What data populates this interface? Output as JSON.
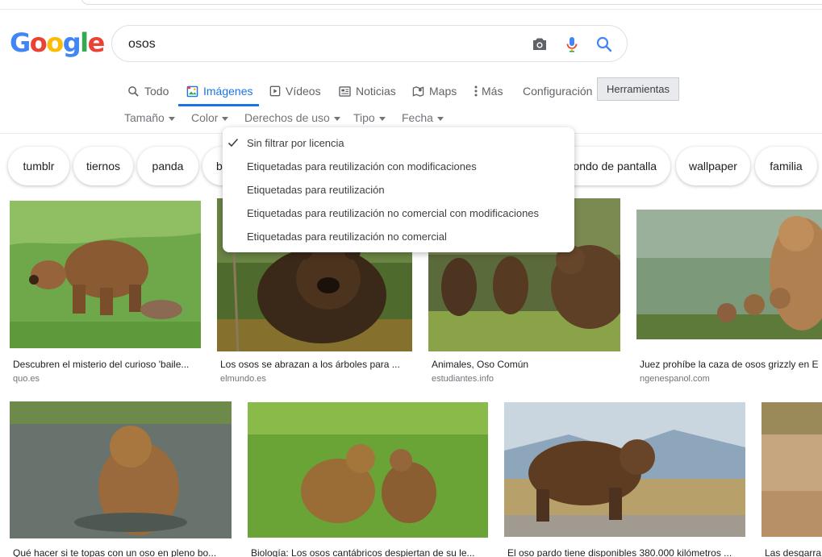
{
  "search": {
    "logo": "Google",
    "query": "osos"
  },
  "nav": {
    "tabs": [
      {
        "label": "Todo",
        "icon": "search-icon"
      },
      {
        "label": "Imágenes",
        "icon": "image-icon",
        "active": true
      },
      {
        "label": "Vídeos",
        "icon": "video-icon"
      },
      {
        "label": "Noticias",
        "icon": "news-icon"
      },
      {
        "label": "Maps",
        "icon": "map-icon"
      },
      {
        "label": "Más",
        "icon": "more-vertical-icon"
      },
      {
        "label": "Configuración"
      }
    ],
    "tools_label": "Herramientas"
  },
  "filters": [
    {
      "label": "Tamaño"
    },
    {
      "label": "Color"
    },
    {
      "label": "Derechos de uso"
    },
    {
      "label": "Tipo"
    },
    {
      "label": "Fecha"
    }
  ],
  "usage_rights_menu": {
    "items": [
      {
        "label": "Sin filtrar por licencia",
        "checked": true
      },
      {
        "label": "Etiquetadas para reutilización con modificaciones"
      },
      {
        "label": "Etiquetadas para reutilización"
      },
      {
        "label": "Etiquetadas para reutilización no comercial con modificaciones"
      },
      {
        "label": "Etiquetadas para reutilización no comercial"
      }
    ]
  },
  "chips": [
    {
      "label": "tumblr"
    },
    {
      "label": "tiernos"
    },
    {
      "label": "panda"
    },
    {
      "label": "b"
    },
    {
      "label": "fondo de pantalla"
    },
    {
      "label": "wallpaper"
    },
    {
      "label": "familia"
    }
  ],
  "results": [
    {
      "caption": "Descubren el misterio del curioso 'baile...",
      "source": "quo.es"
    },
    {
      "caption": "Los osos se abrazan a los árboles para ...",
      "source": "elmundo.es"
    },
    {
      "caption": "Animales, Oso Común",
      "source": "estudiantes.info"
    },
    {
      "caption": "Juez prohíbe la caza de osos grizzly en E",
      "source": "ngenespanol.com"
    },
    {
      "caption": "Qué hacer si te topas con un oso en pleno bo...",
      "source": ""
    },
    {
      "caption": "Biología: Los osos cantábricos despiertan de su le...",
      "source": ""
    },
    {
      "caption": "El oso pardo tiene disponibles 380.000 kilómetros ...",
      "source": ""
    },
    {
      "caption": "Las desgarra",
      "source": ""
    }
  ],
  "colors": {
    "accent": "#1a73e8",
    "tab_text": "#5f6368",
    "filter_text": "#70757a"
  }
}
